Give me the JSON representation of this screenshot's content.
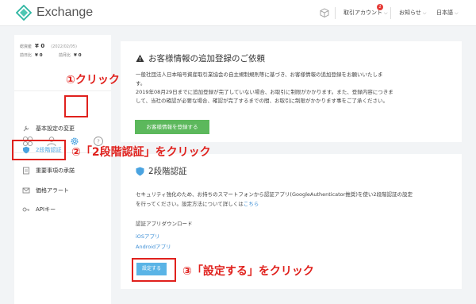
{
  "header": {
    "app_name": "Exchange",
    "account_menu": "取引アカウント",
    "notification_count": "2",
    "news_menu": "お知らせ",
    "language_menu": "日本語"
  },
  "sidebar": {
    "total_assets_label": "総資産",
    "total_assets_value": "¥ 0",
    "date": "(2022/02/05)",
    "prev_day_label": "前日比",
    "prev_day_value": "¥ 0",
    "prev_month_label": "前月比",
    "prev_month_value": "¥ 0",
    "items": [
      {
        "label": "基本設定の変更"
      },
      {
        "label": "2段階認証"
      },
      {
        "label": "重要事項の承諾"
      },
      {
        "label": "価格アラート"
      },
      {
        "label": "APIキー"
      }
    ]
  },
  "info_card": {
    "title": "お客様情報の追加登録のご依頼",
    "line1": "一般社団法人日本暗号資産取引業協会の自主規制規則等に基づき、お客様情報の追加登録をお願いいたしま",
    "line2": "す。",
    "line3": "2019年08月29日までに追加登録が完了していない場合、お取引に制限がかかります。また、登録内容につきま",
    "line4": "して、当社の確認が必要な場合、確認が完了するまでの間、お取引に制限がかかります事をご了承ください。",
    "button": "お客様情報を登録する"
  },
  "tfa_card": {
    "title": "2段階認証",
    "desc1": "セキュリティ強化のため、お持ちのスマートフォンから認証アプリ(GoogleAuthenticator推奨)を使い2段階認証の設定",
    "desc2": "を行ってください。設定方法について詳しくは",
    "desc2_link": "こちら",
    "download_label": "認証アプリダウンロード",
    "ios_link": "iOSアプリ",
    "android_link": "Androidアプリ",
    "setup_button": "設定する"
  },
  "annotations": {
    "step1": "①クリック",
    "step2": "②「2段階認証」をクリック",
    "step3": "③「設定する」をクリック"
  },
  "colors": {
    "accent_green": "#5cb85c",
    "accent_blue": "#5ab4e6",
    "annotation_red": "#e0211d",
    "link_blue": "#3d8fd6"
  }
}
